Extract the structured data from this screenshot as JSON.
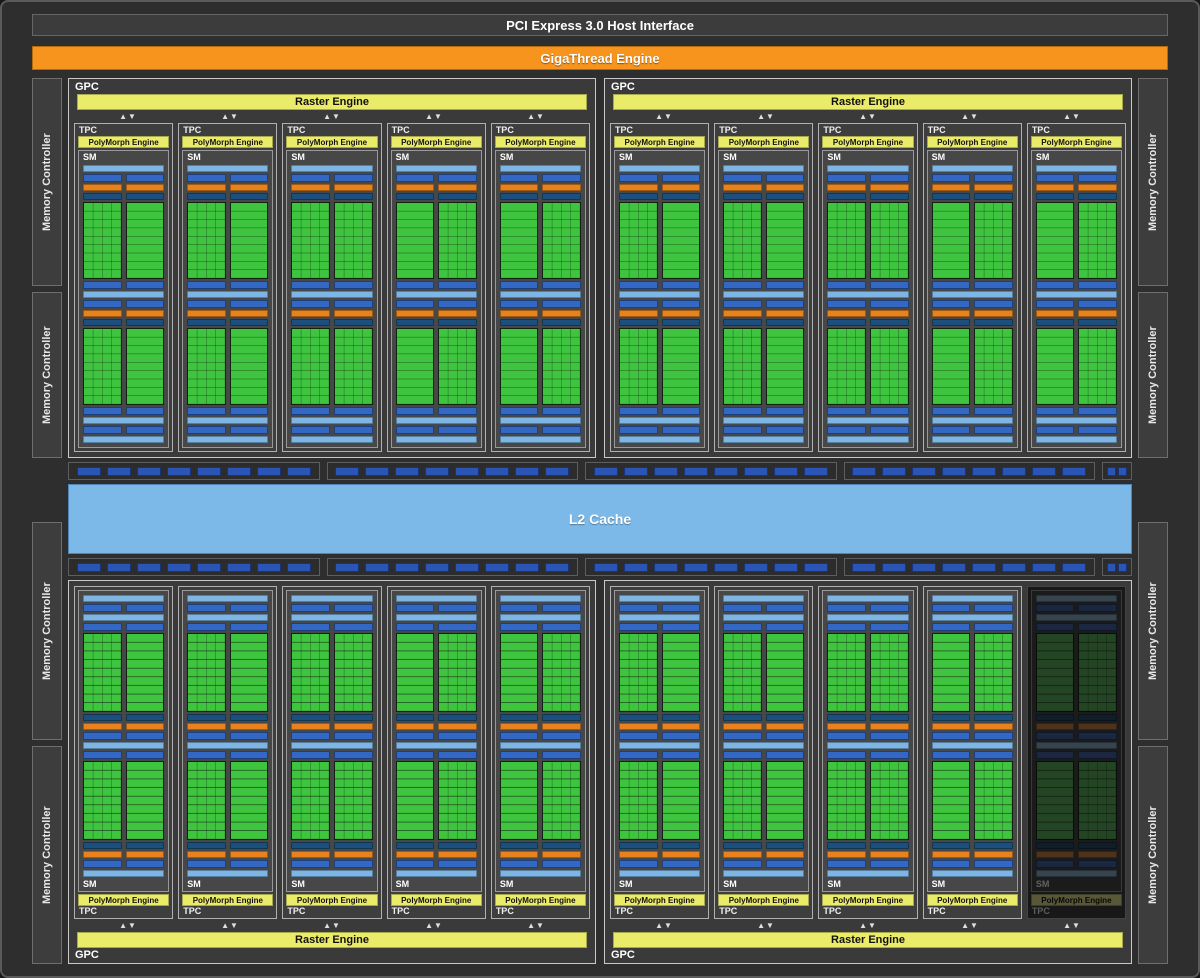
{
  "diagram": {
    "host_interface": "PCI Express 3.0 Host Interface",
    "gigathread": "GigaThread Engine",
    "l2_cache": "L2 Cache",
    "labels": {
      "gpc": "GPC",
      "raster": "Raster Engine",
      "tpc": "TPC",
      "polymorph": "PolyMorph Engine",
      "sm": "SM",
      "memory_controller": "Memory Controller"
    },
    "icons": {
      "updown_arrow": "▲▼"
    },
    "structure": {
      "gpc_count": 4,
      "tpcs_per_gpc": 5,
      "sms_per_tpc": 1,
      "core_grid": {
        "columns_per_partition": 4,
        "rows": 8,
        "partitions_per_sm": 2,
        "cores_per_sm": 128
      },
      "memory_controllers_per_side": 4,
      "rop_groups_per_strip": 4,
      "boxes_per_rop_group": 8,
      "edge_boxes_per_strip": 2,
      "disabled_tpc": {
        "gpc_index": 3,
        "tpc_index": 4
      }
    },
    "colors": {
      "background": "#2e2e2e",
      "panel": "#3a3a3a",
      "orange": "#f7941e",
      "yellow": "#ebeb6a",
      "light_blue": "#7db6e4",
      "blue": "#3368c4",
      "navy": "#1d4f7e",
      "rop_blue": "#2b55b4",
      "green": "#3ec43e",
      "l2_blue": "#7cb9e8"
    }
  }
}
